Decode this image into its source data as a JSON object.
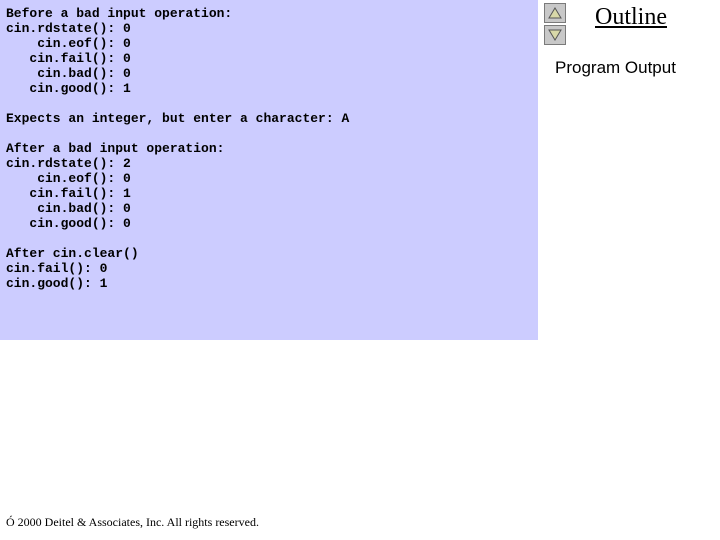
{
  "code": {
    "line1": "Before a bad input operation:",
    "line2": "cin.rdstate(): 0",
    "line3": "    cin.eof(): 0",
    "line4": "   cin.fail(): 0",
    "line5": "    cin.bad(): 0",
    "line6": "   cin.good(): 1",
    "line7": "",
    "line8": "Expects an integer, but enter a character: A",
    "line9": "",
    "line10": "After a bad input operation:",
    "line11": "cin.rdstate(): 2",
    "line12": "    cin.eof(): 0",
    "line13": "   cin.fail(): 1",
    "line14": "    cin.bad(): 0",
    "line15": "   cin.good(): 0",
    "line16": "",
    "line17": "After cin.clear()",
    "line18": "cin.fail(): 0",
    "line19": "cin.good(): 1"
  },
  "outline": {
    "title": "Outline",
    "section": "Program Output"
  },
  "footer": {
    "symbol": "Ó",
    "text": "2000 Deitel & Associates, Inc.   All rights reserved."
  }
}
